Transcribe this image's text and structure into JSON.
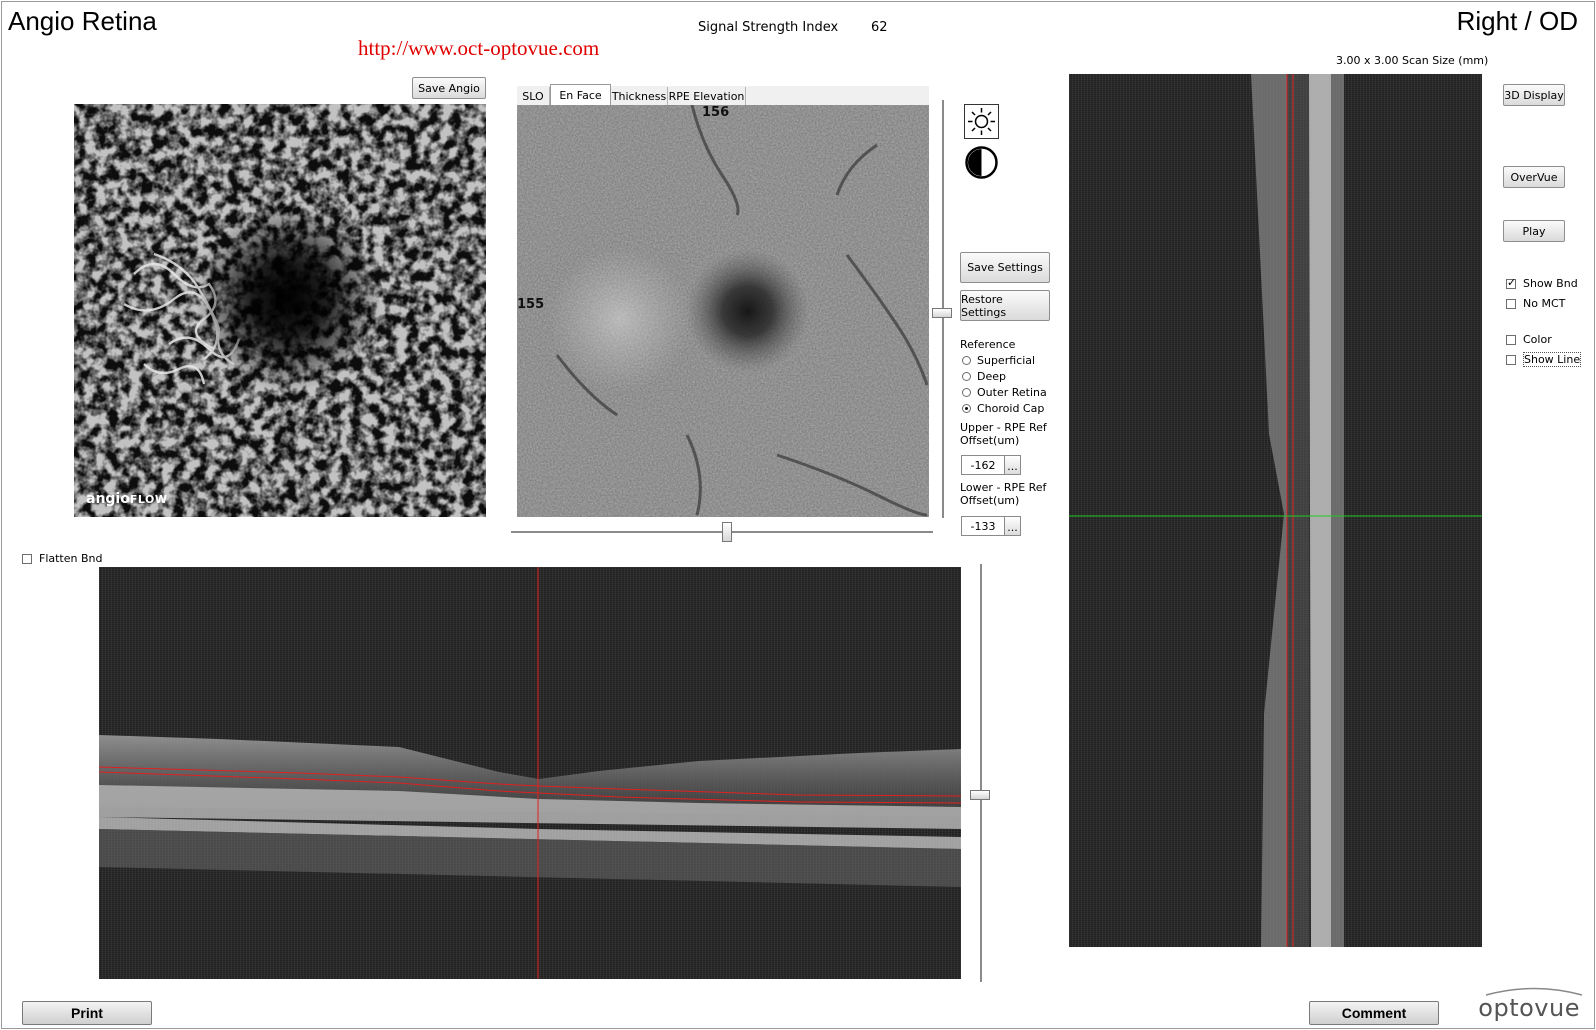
{
  "header": {
    "title": "Angio Retina",
    "eye": "Right / OD",
    "url_watermark": "http://www.oct-optovue.com",
    "signal_strength_label": "Signal Strength Index",
    "signal_strength_value": "62",
    "scan_size": "3.00 x 3.00 Scan Size (mm)"
  },
  "angio_panel": {
    "save_button": "Save Angio",
    "logo_main": "angio",
    "logo_sub": "FLOW"
  },
  "enface_panel": {
    "tabs": [
      {
        "label": "SLO",
        "active": false
      },
      {
        "label": "En Face",
        "active": true
      },
      {
        "label": "Thickness",
        "active": false
      },
      {
        "label": "RPE Elevation",
        "active": false
      }
    ],
    "top_number": "156",
    "left_number": "155"
  },
  "settings": {
    "brightness_icon": "sun-icon",
    "contrast_icon": "contrast-icon",
    "save_settings": "Save Settings",
    "restore_settings": "Restore Settings",
    "reference_label": "Reference",
    "reference_options": [
      {
        "label": "Superficial",
        "selected": false
      },
      {
        "label": "Deep",
        "selected": false
      },
      {
        "label": "Outer Retina",
        "selected": false
      },
      {
        "label": "Choroid Cap",
        "selected": true
      }
    ],
    "upper_label_1": "Upper - RPE Ref",
    "upper_label_2": "Offset(um)",
    "upper_value": "-162",
    "lower_label_1": "Lower - RPE Ref",
    "lower_label_2": "Offset(um)",
    "lower_value": "-133",
    "ellipsis": "..."
  },
  "bscan_panel": {
    "flatten_label": "Flatten Bnd",
    "flatten_checked": false
  },
  "right_controls": {
    "display_3d": "3D Display",
    "overvue": "OverVue",
    "play": "Play",
    "checkboxes": [
      {
        "label": "Show Bnd",
        "checked": true
      },
      {
        "label": "No MCT",
        "checked": false
      },
      {
        "label": "Color",
        "checked": false
      },
      {
        "label": "Show Line",
        "checked": false
      }
    ]
  },
  "footer": {
    "print": "Print",
    "comment": "Comment",
    "brand": "optovue"
  },
  "colors": {
    "url": "#e00000",
    "segmentation_line": "#e02020",
    "horizontal_marker": "#22cc22"
  }
}
